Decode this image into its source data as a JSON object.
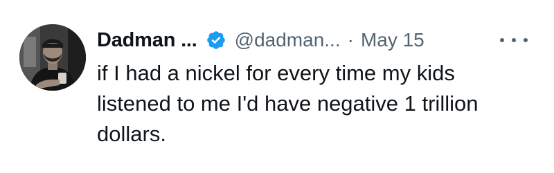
{
  "tweet": {
    "author": {
      "display_name": "Dadman ...",
      "handle": "@dadman...",
      "verified": true,
      "avatar_icon": "profile-photo"
    },
    "separator": "·",
    "date": "May 15",
    "more_icon": "more-options-icon",
    "text_lines": [
      "if I had a nickel for every time my kids",
      "listened to me I'd have negative 1 trillion",
      "dollars."
    ]
  },
  "colors": {
    "text_primary": "#0f1419",
    "text_secondary": "#536471",
    "verified_blue": "#1d9bf0",
    "background": "#ffffff"
  }
}
